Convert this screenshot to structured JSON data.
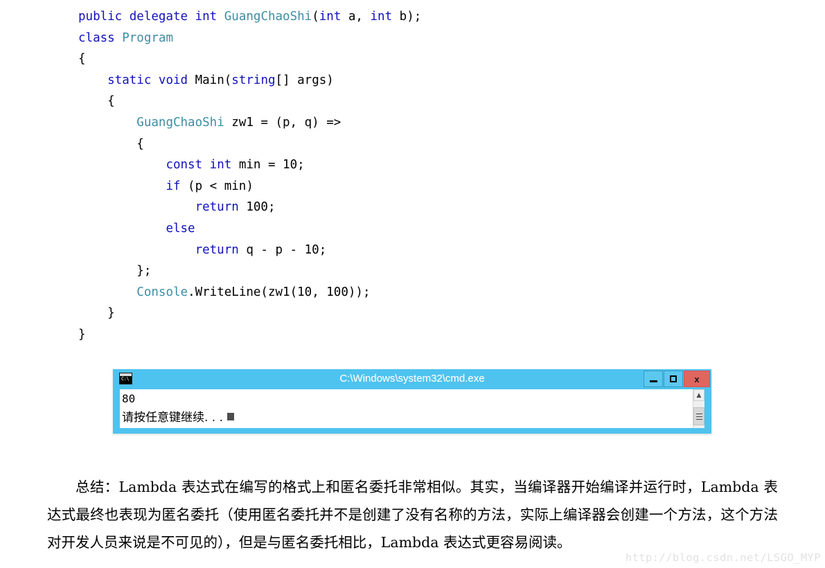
{
  "code": {
    "language": "csharp",
    "lines": [
      [
        {
          "t": "public",
          "c": "kw"
        },
        {
          "t": " ",
          "c": "pln"
        },
        {
          "t": "delegate",
          "c": "kw"
        },
        {
          "t": " ",
          "c": "pln"
        },
        {
          "t": "int",
          "c": "kw"
        },
        {
          "t": " ",
          "c": "pln"
        },
        {
          "t": "GuangChaoShi",
          "c": "typ"
        },
        {
          "t": "(",
          "c": "pln"
        },
        {
          "t": "int",
          "c": "kw"
        },
        {
          "t": " a, ",
          "c": "pln"
        },
        {
          "t": "int",
          "c": "kw"
        },
        {
          "t": " b);",
          "c": "pln"
        }
      ],
      [
        {
          "t": "class",
          "c": "kw"
        },
        {
          "t": " ",
          "c": "pln"
        },
        {
          "t": "Program",
          "c": "typ"
        }
      ],
      [
        {
          "t": "{",
          "c": "pln"
        }
      ],
      [
        {
          "t": "    ",
          "c": "pln"
        },
        {
          "t": "static",
          "c": "kw"
        },
        {
          "t": " ",
          "c": "pln"
        },
        {
          "t": "void",
          "c": "kw"
        },
        {
          "t": " Main(",
          "c": "pln"
        },
        {
          "t": "string",
          "c": "kw"
        },
        {
          "t": "[] args)",
          "c": "pln"
        }
      ],
      [
        {
          "t": "    {",
          "c": "pln"
        }
      ],
      [
        {
          "t": "        ",
          "c": "pln"
        },
        {
          "t": "GuangChaoShi",
          "c": "typ"
        },
        {
          "t": " zw1 = (p, q) =>",
          "c": "pln"
        }
      ],
      [
        {
          "t": "        {",
          "c": "pln"
        }
      ],
      [
        {
          "t": "            ",
          "c": "pln"
        },
        {
          "t": "const",
          "c": "kw"
        },
        {
          "t": " ",
          "c": "pln"
        },
        {
          "t": "int",
          "c": "kw"
        },
        {
          "t": " min = ",
          "c": "pln"
        },
        {
          "t": "10;",
          "c": "num"
        }
      ],
      [
        {
          "t": "            ",
          "c": "pln"
        },
        {
          "t": "if",
          "c": "kw"
        },
        {
          "t": " (p < min)",
          "c": "pln"
        }
      ],
      [
        {
          "t": "                ",
          "c": "pln"
        },
        {
          "t": "return",
          "c": "kw"
        },
        {
          "t": " ",
          "c": "pln"
        },
        {
          "t": "100;",
          "c": "num"
        }
      ],
      [
        {
          "t": "            ",
          "c": "pln"
        },
        {
          "t": "else",
          "c": "kw"
        }
      ],
      [
        {
          "t": "                ",
          "c": "pln"
        },
        {
          "t": "return",
          "c": "kw"
        },
        {
          "t": " q - p - ",
          "c": "pln"
        },
        {
          "t": "10;",
          "c": "num"
        }
      ],
      [
        {
          "t": "        };",
          "c": "pln"
        }
      ],
      [
        {
          "t": "        ",
          "c": "pln"
        },
        {
          "t": "Console",
          "c": "typ"
        },
        {
          "t": ".WriteLine(zw1(",
          "c": "pln"
        },
        {
          "t": "10",
          "c": "num"
        },
        {
          "t": ", ",
          "c": "pln"
        },
        {
          "t": "100",
          "c": "num"
        },
        {
          "t": "));",
          "c": "pln"
        }
      ],
      [
        {
          "t": "    }",
          "c": "pln"
        }
      ],
      [
        {
          "t": "}",
          "c": "pln"
        }
      ]
    ]
  },
  "console_window": {
    "title": "C:\\Windows\\system32\\cmd.exe",
    "app_icon_label": "C:\\",
    "titlebar_color": "#4ec3ef",
    "close_button_color": "#e0655f",
    "controls": {
      "minimize_label": "Minimize",
      "maximize_label": "Maximize",
      "close_label": "x"
    },
    "output": {
      "line1": "80",
      "line2": "请按任意键继续. . ."
    },
    "scrollbar": {
      "up_arrow_glyph": "▲"
    }
  },
  "summary": {
    "text": "总结：Lambda 表达式在编写的格式上和匿名委托非常相似。其实，当编译器开始编译并运行时，Lambda 表达式最终也表现为匿名委托（使用匿名委托并不是创建了没有名称的方法，实际上编译器会创建一个方法，这个方法对开发人员来说是不可见的），但是与匿名委托相比，Lambda 表达式更容易阅读。"
  },
  "watermark": {
    "text": "http://blog.csdn.net/LSGO_MYP"
  }
}
